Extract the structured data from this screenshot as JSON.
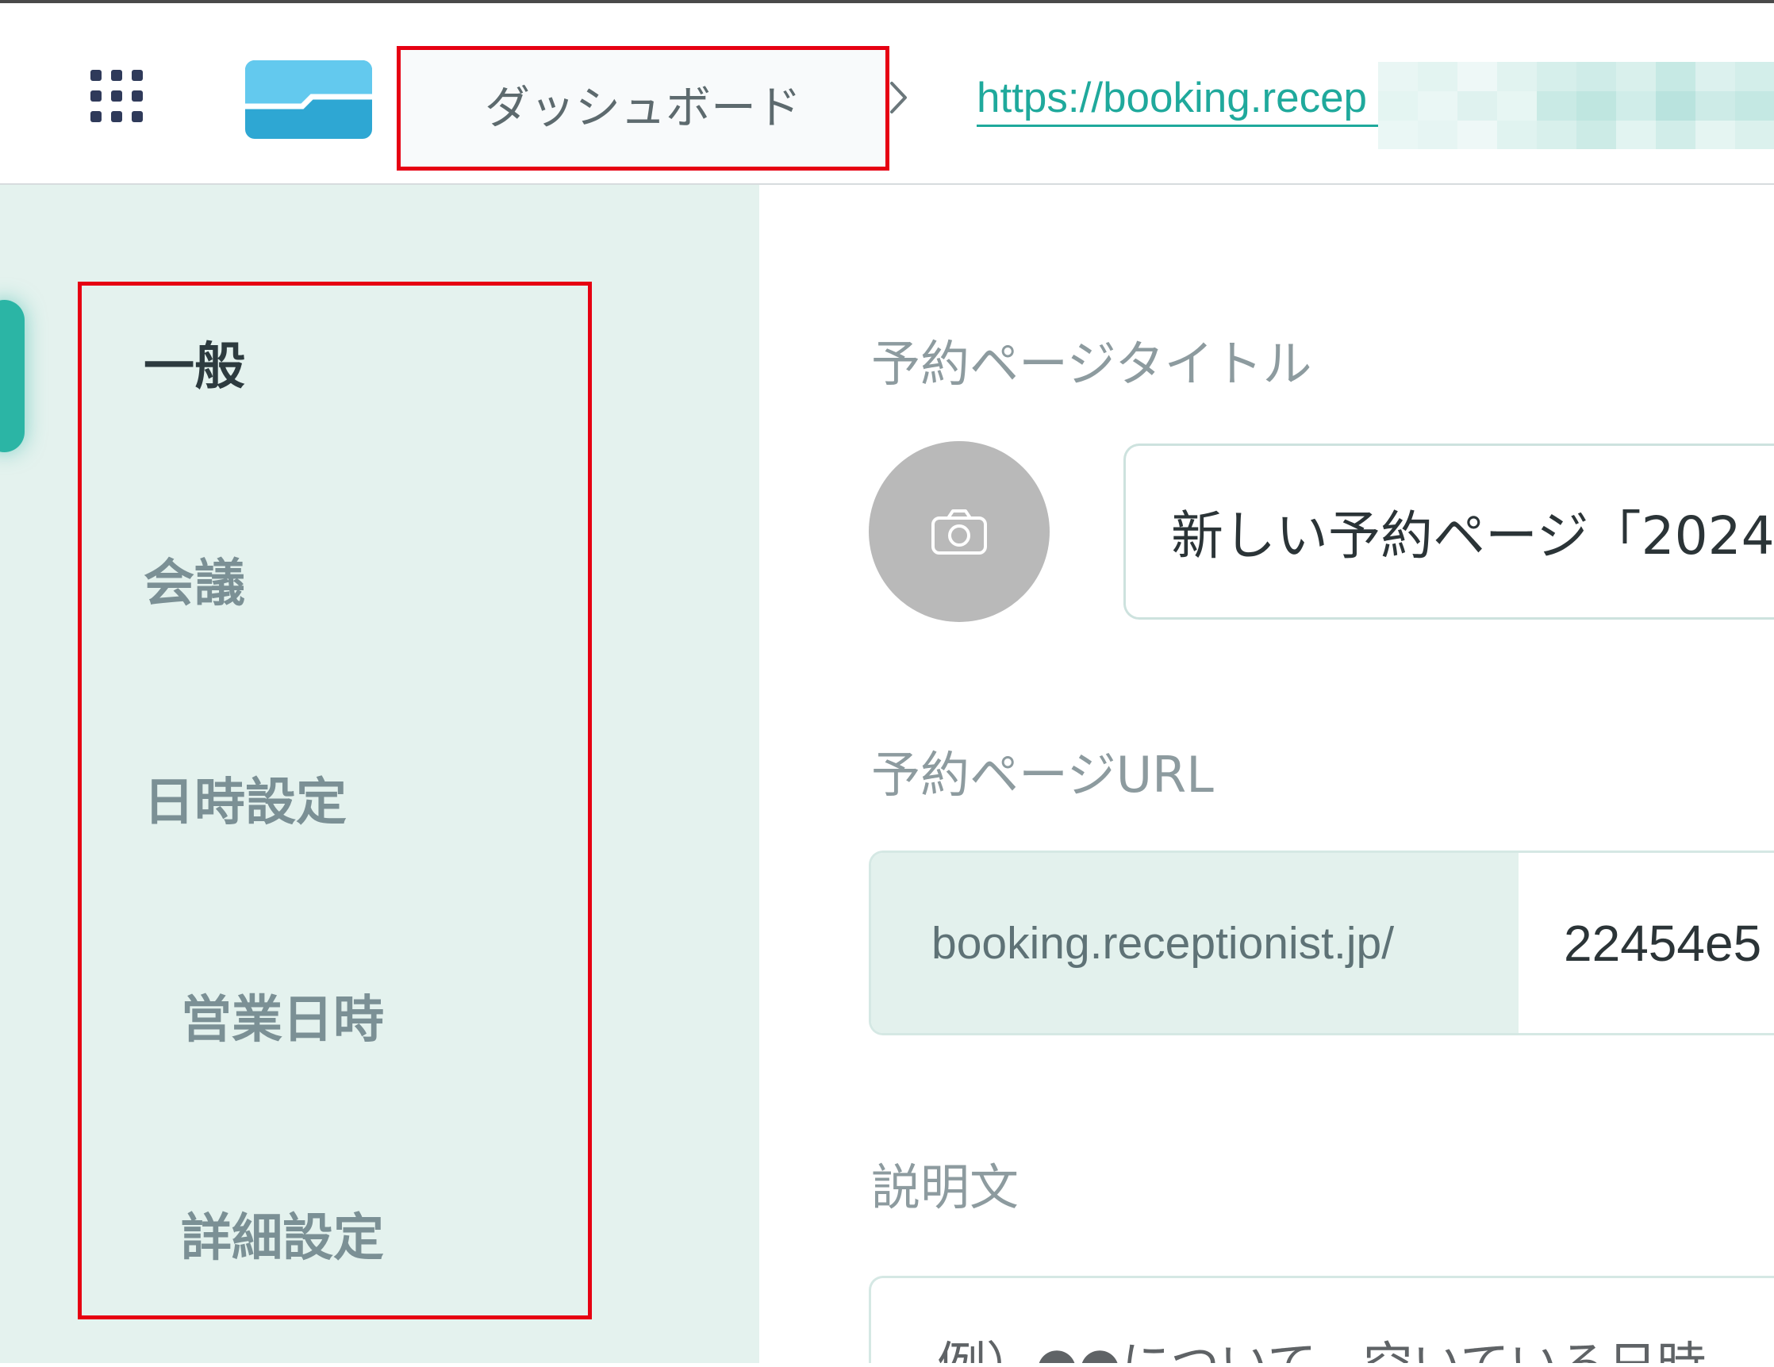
{
  "header": {
    "breadcrumb": {
      "dashboard_label": "ダッシュボード"
    },
    "booking_url": {
      "visible_text": "https://booking.recep"
    }
  },
  "sidebar": {
    "items": [
      {
        "label": "一般",
        "active": true
      },
      {
        "label": "会議",
        "active": false
      },
      {
        "label": "日時設定",
        "active": false
      },
      {
        "label": "営業日時",
        "active": false
      },
      {
        "label": "詳細設定",
        "active": false
      }
    ]
  },
  "form": {
    "title": {
      "label": "予約ページタイトル",
      "value": "新しい予約ページ「2024"
    },
    "url": {
      "label": "予約ページURL",
      "prefix": "booking.receptionist.jp/",
      "value": "22454e5"
    },
    "description": {
      "label": "説明文",
      "placeholder": "例）●●について、空いている日時"
    }
  },
  "icons": {
    "apps": "apps-grid-icon",
    "logo": "app-logo",
    "breadcrumb_separator": "chevron-right-icon",
    "photo_upload": "camera-icon"
  },
  "colors": {
    "accent": "#2bb5a5",
    "link": "#1fa99c",
    "sidebar_bg": "#e4f2ee",
    "highlight": "#e60012",
    "logo_light": "#63c9ee",
    "logo_dark": "#2ea7d3"
  }
}
